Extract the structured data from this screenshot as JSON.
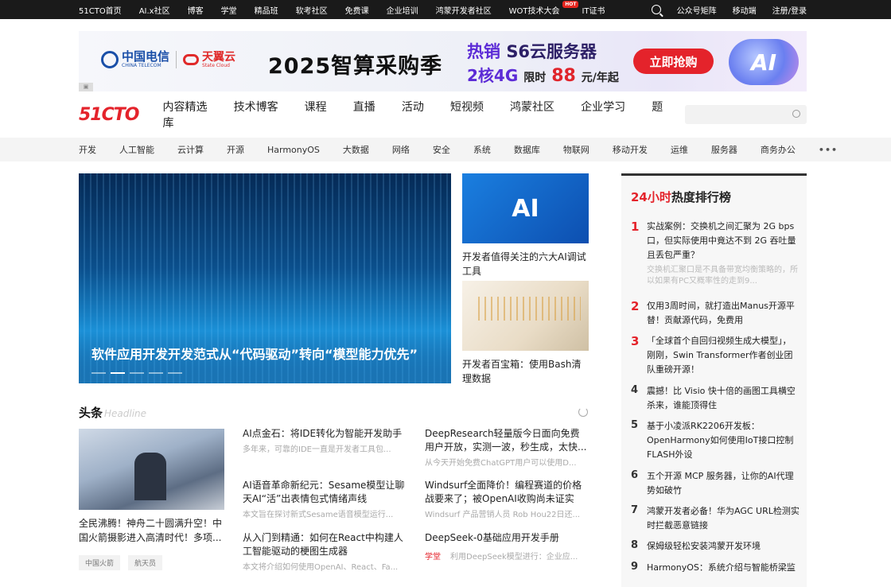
{
  "topbar": {
    "left": [
      "51CTO首页",
      "AI.x社区",
      "博客",
      "学堂",
      "精品班",
      "软考社区",
      "免费课",
      "企业培训",
      "鸿蒙开发者社区",
      "WOT技术大会",
      "IT证书"
    ],
    "hot_badge": "HOT",
    "right": [
      "公众号矩阵",
      "移动端",
      "注册/登录"
    ]
  },
  "banner": {
    "brand1": "中国电信",
    "brand1_sub": "CHINA TELECOM",
    "brand2": "天翼云",
    "brand2_sub": "State Cloud",
    "headline": "2025智算采购季",
    "promo_line1_a": "热销",
    "promo_line1_b": "S6云服务器",
    "promo_line2_a": "2核4G",
    "promo_line2_b": "限时",
    "promo_price": "88",
    "promo_unit": "元/年起",
    "cta": "立即抢购",
    "art_text": "AI"
  },
  "mainnav": {
    "brand": "51CTO",
    "items": [
      "内容精选",
      "技术博客",
      "课程",
      "直播",
      "活动",
      "短视频",
      "鸿蒙社区",
      "企业学习",
      "题库"
    ]
  },
  "categories": [
    "开发",
    "人工智能",
    "云计算",
    "开源",
    "HarmonyOS",
    "大数据",
    "网络",
    "安全",
    "系统",
    "数据库",
    "物联网",
    "移动开发",
    "运维",
    "服务器",
    "商务办公"
  ],
  "more": "•••",
  "hero": {
    "caption": "软件应用开发开发范式从“代码驱动”转向“模型能力优先”"
  },
  "side_cards": [
    {
      "img_text": "AI",
      "title": "开发者值得关注的六大AI调试工具"
    },
    {
      "title": "开发者百宝箱：使用Bash清理数据"
    }
  ],
  "headline_section": {
    "title": "头条",
    "title_en": "Headline",
    "main_title": "全民沸腾！神舟二十圆满升空！中国火箭摄影进入高清时代！多项...",
    "tags": [
      "中国火箭",
      "航天员"
    ],
    "articles": [
      {
        "title": "AI点金石：将IDE转化为智能开发助手",
        "desc": "多年来，可靠的IDE一直是开发者工具包..."
      },
      {
        "title": "DeepResearch轻量版今日面向免费用户开放，实测一波，秒生成，太快...",
        "desc": "从今天开始免费ChatGPT用户可以使用D..."
      },
      {
        "title": "AI语音革命新纪元：Sesame模型让聊天AI“活”出表情包式情绪声线",
        "desc": "本文旨在探讨新式Sesame语音模型运行..."
      },
      {
        "title": "Windsurf全面降价！编程赛道的价格战要来了；被OpenAI收购尚未证实",
        "desc": "Windsurf 产品营销人员 Rob Hou22日还..."
      },
      {
        "title": "从入门到精通：如何在React中构建人工智能驱动的梗图生成器",
        "desc": "本文将介绍如何使用OpenAI、React、Fa..."
      },
      {
        "title": "DeepSeek-0基础应用开发手册",
        "desc_tag": "学堂",
        "desc": "利用DeepSeek模型进行：企业应..."
      }
    ]
  },
  "ranking": {
    "title_red": "24小时",
    "title_rest": "热度排行榜",
    "items": [
      {
        "n": "1",
        "title": "实战案例：交换机之间汇聚为 2G bps 口，但实际使用中竟达不到 2G 吞吐量且丢包严重？",
        "desc": "交换机汇聚口是不具备带宽均衡策略的，所以如果有PC又概率性的走到9..."
      },
      {
        "n": "2",
        "title": "仅用3周时间，就打造出Manus开源平替！贡献源代码，免费用"
      },
      {
        "n": "3",
        "title": "「全球首个自回归视频生成大模型」，刚刚，Swin Transformer作者创业团队重磅开源！"
      },
      {
        "n": "4",
        "title": "震撼！比 Visio 快十倍的画图工具横空杀来，谁能顶得住"
      },
      {
        "n": "5",
        "title": "基于小凌派RK2206开发板：OpenHarmony如何使用IoT接口控制FLASH外设"
      },
      {
        "n": "6",
        "title": "五个开源 MCP 服务器，让你的AI代理势如破竹"
      },
      {
        "n": "7",
        "title": "鸿蒙开发者必备！华为AGC URL检测实时拦截恶意链接"
      },
      {
        "n": "8",
        "title": "保姆级轻松安装鸿蒙开发环境"
      },
      {
        "n": "9",
        "title": "HarmonyOS：系统介绍与智能桥梁监"
      }
    ]
  }
}
